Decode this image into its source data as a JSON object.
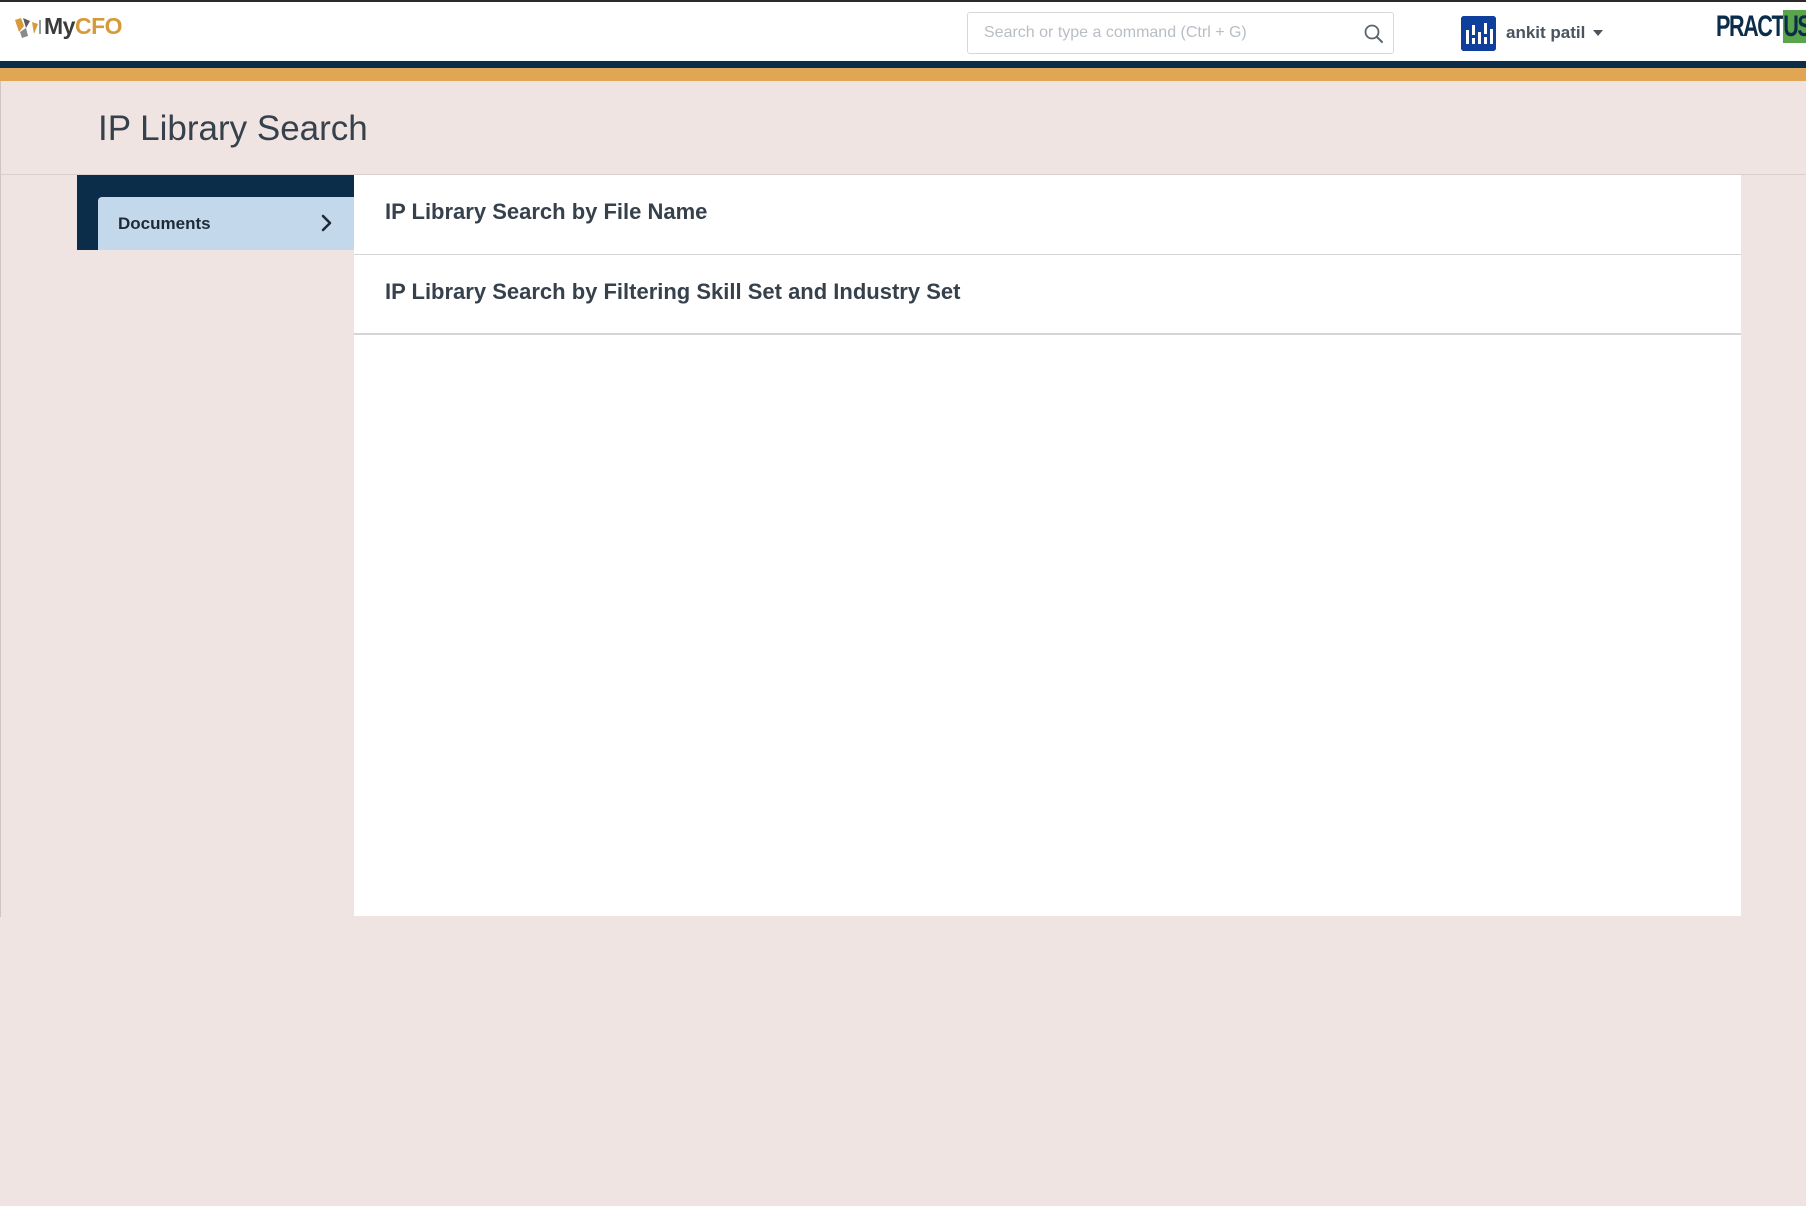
{
  "navbar": {
    "brand": {
      "my": "My",
      "cfo": "CFO"
    },
    "search": {
      "placeholder": "Search or type a command (Ctrl + G)",
      "value": ""
    },
    "user": {
      "name": "ankit patil"
    },
    "partner": {
      "word_a": "PRACT",
      "word_b": "US"
    }
  },
  "page": {
    "title": "IP Library Search"
  },
  "sidebar": {
    "items": [
      {
        "label": "Documents",
        "active": true
      }
    ]
  },
  "main": {
    "items": [
      {
        "label": "IP Library Search by File Name"
      },
      {
        "label": "IP Library Search by Filtering Skill Set and Industry Set"
      }
    ]
  },
  "colors": {
    "navy": "#0b2d4a",
    "gold": "#e0a654",
    "page_bg": "#efe4e2",
    "sidebar_active": "#c3d9eb",
    "avatar": "#0f3f9c",
    "partner_green": "#5aa54b"
  }
}
